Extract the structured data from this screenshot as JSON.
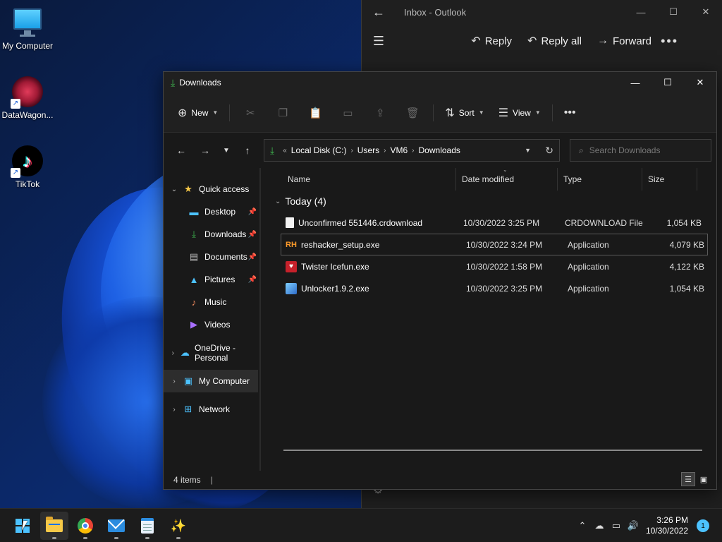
{
  "desktop": {
    "icons": [
      {
        "label": "My Computer",
        "icon": "monitor-icon"
      },
      {
        "label": "DataWagon...",
        "icon": "datawagon-logo-icon"
      },
      {
        "label": "TikTok",
        "icon": "tiktok-logo-icon"
      }
    ]
  },
  "outlook": {
    "title": "Inbox - Outlook",
    "actions": {
      "reply": "Reply",
      "reply_all": "Reply all",
      "forward": "Forward"
    }
  },
  "explorer": {
    "title": "Downloads",
    "toolbar": {
      "new_label": "New",
      "sort_label": "Sort",
      "view_label": "View"
    },
    "address": {
      "breadcrumbs": [
        "Local Disk (C:)",
        "Users",
        "VM6",
        "Downloads"
      ]
    },
    "search": {
      "placeholder": "Search Downloads"
    },
    "nav": {
      "quick_access": "Quick access",
      "items": [
        {
          "label": "Desktop",
          "icon": "desktop-icon",
          "pinned": true
        },
        {
          "label": "Downloads",
          "icon": "download-arrow-icon",
          "pinned": true
        },
        {
          "label": "Documents",
          "icon": "documents-icon",
          "pinned": true
        },
        {
          "label": "Pictures",
          "icon": "pictures-icon",
          "pinned": true
        },
        {
          "label": "Music",
          "icon": "music-icon",
          "pinned": false
        },
        {
          "label": "Videos",
          "icon": "videos-icon",
          "pinned": false
        }
      ],
      "onedrive": "OneDrive - Personal",
      "my_computer": "My Computer",
      "network": "Network"
    },
    "columns": {
      "name": "Name",
      "date": "Date modified",
      "type": "Type",
      "size": "Size"
    },
    "group": "Today (4)",
    "files": [
      {
        "name": "Unconfirmed 551446.crdownload",
        "date": "10/30/2022 3:25 PM",
        "type": "CRDOWNLOAD File",
        "size": "1,054 KB",
        "icon": "blank-file-icon"
      },
      {
        "name": "reshacker_setup.exe",
        "date": "10/30/2022 3:24 PM",
        "type": "Application",
        "size": "4,079 KB",
        "icon": "reshacker-icon"
      },
      {
        "name": "Twister Icefun.exe",
        "date": "10/30/2022 1:58 PM",
        "type": "Application",
        "size": "4,122 KB",
        "icon": "twister-icon"
      },
      {
        "name": "Unlocker1.9.2.exe",
        "date": "10/30/2022 3:25 PM",
        "type": "Application",
        "size": "1,054 KB",
        "icon": "unlocker-icon"
      }
    ],
    "status": {
      "count": "4 items"
    }
  },
  "taskbar": {
    "apps": [
      "start-icon",
      "file-explorer-icon",
      "chrome-icon",
      "mail-icon",
      "notepad-icon",
      "magic-wand-icon"
    ],
    "clock": {
      "time": "3:26 PM",
      "date": "10/30/2022"
    },
    "notifications": "1"
  },
  "colors": {
    "accent": "#4cc2ff",
    "downloads_green": "#3fb950",
    "window_bg": "#191919"
  }
}
